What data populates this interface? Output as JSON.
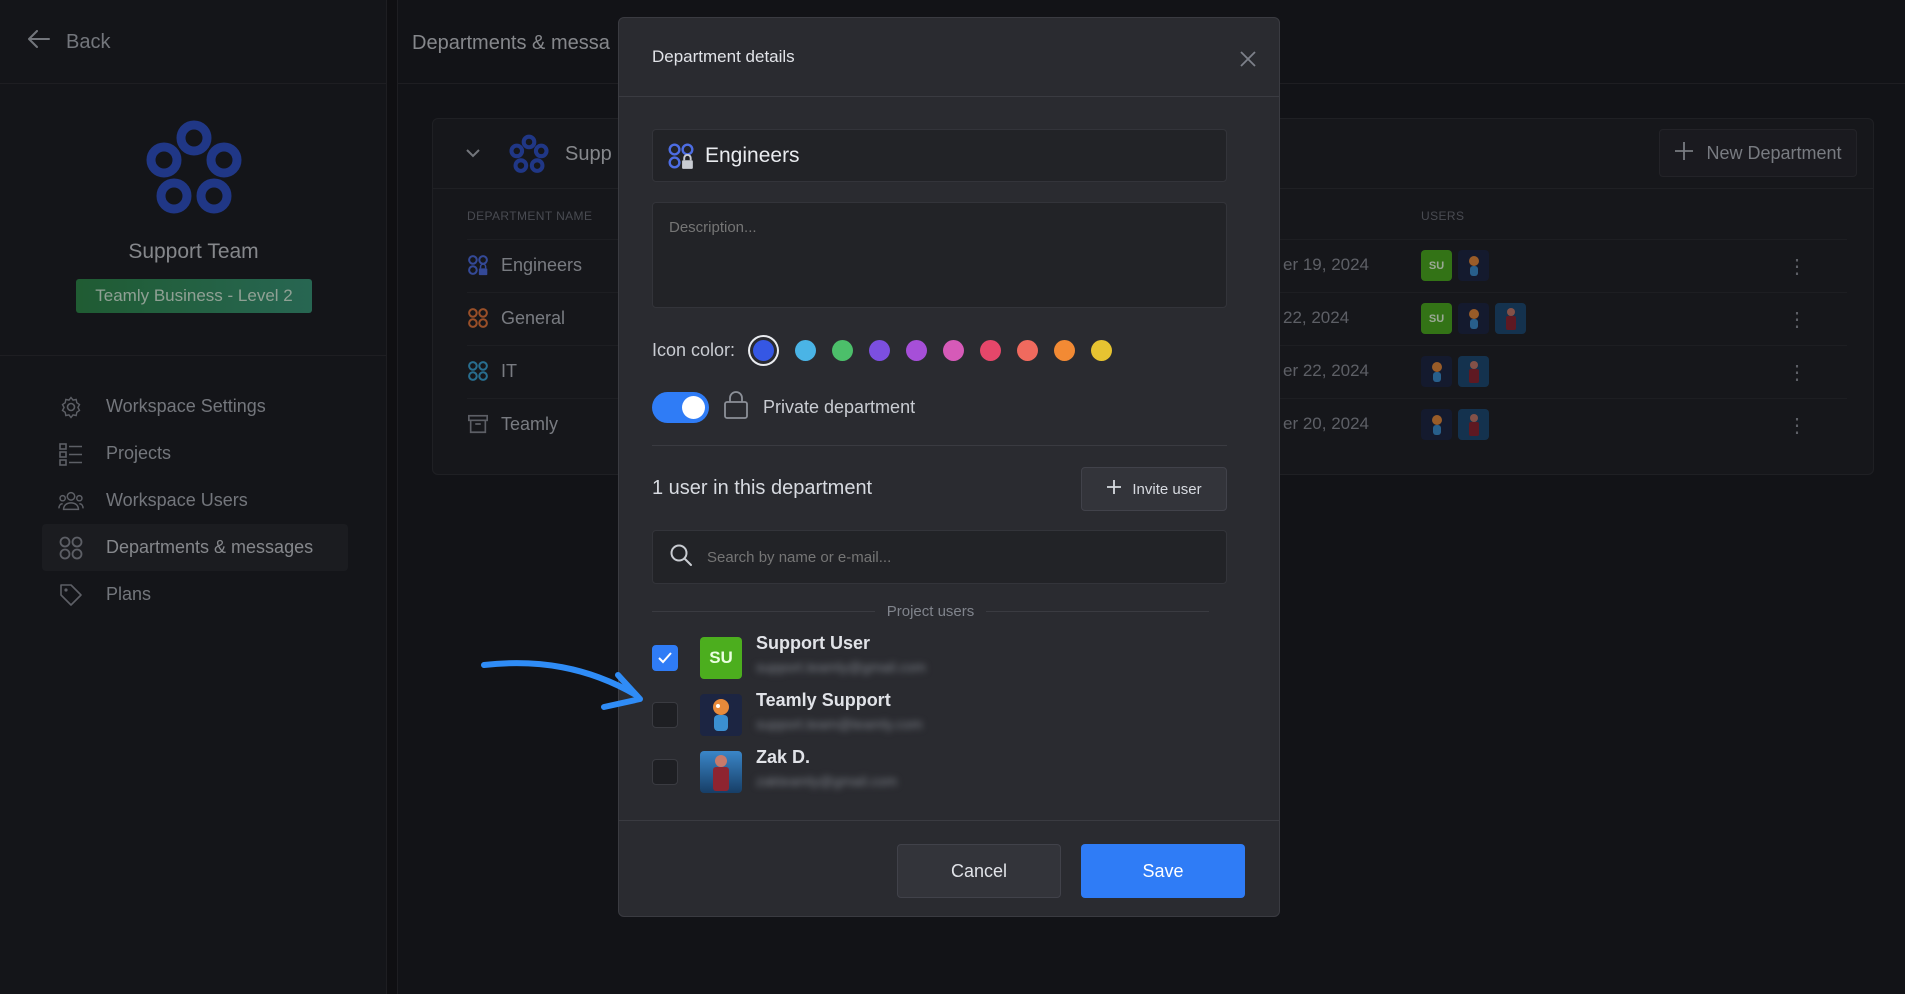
{
  "sidebar": {
    "back_label": "Back",
    "team_name": "Support Team",
    "plan_badge": "Teamly Business - Level 2",
    "items": [
      {
        "label": "Workspace Settings",
        "icon": "gear-icon"
      },
      {
        "label": "Projects",
        "icon": "list-icon"
      },
      {
        "label": "Workspace Users",
        "icon": "users-icon"
      },
      {
        "label": "Departments & messages",
        "icon": "grid-icon",
        "active": true
      },
      {
        "label": "Plans",
        "icon": "tag-icon"
      }
    ]
  },
  "main": {
    "title": "Departments & messa",
    "panel_title": "Supp",
    "new_department_label": "New Department",
    "col_department_name": "DEPARTMENT NAME",
    "col_users": "USERS",
    "rows": [
      {
        "name": "Engineers",
        "date": "er 19, 2024",
        "icon_color": "#4d6de3"
      },
      {
        "name": "General",
        "date": "22, 2024",
        "icon_color": "#e8773a"
      },
      {
        "name": "IT",
        "date": "er 22, 2024",
        "icon_color": "#3ba6d8"
      },
      {
        "name": "Teamly",
        "date": "er 20, 2024",
        "icon_color": "#8c9098"
      }
    ]
  },
  "modal": {
    "title": "Department details",
    "name_value": "Engineers",
    "description_placeholder": "Description...",
    "icon_color_label": "Icon color:",
    "colors": [
      "#3557e4",
      "#4ab4e6",
      "#4cbf6a",
      "#7c4fe0",
      "#a64fd8",
      "#d65ab8",
      "#e5476a",
      "#f06a5e",
      "#f28a34",
      "#e6c331"
    ],
    "selected_color": "#3557e4",
    "private_label": "Private department",
    "private_enabled": true,
    "user_count_text": "1 user in this department",
    "invite_label": "Invite user",
    "search_placeholder": "Search by name or e-mail...",
    "section_label": "Project users",
    "users": [
      {
        "name": "Support User",
        "initials": "SU",
        "checked": true,
        "email": "support.teamly@gmail.com"
      },
      {
        "name": "Teamly Support",
        "initials": "",
        "checked": false,
        "email": "support.team@teamly.com"
      },
      {
        "name": "Zak D.",
        "initials": "",
        "checked": false,
        "email": "zakteamly@gmail.com"
      }
    ],
    "cancel_label": "Cancel",
    "save_label": "Save"
  },
  "colors": {
    "accent": "#2f7cf6",
    "badge": "#2e8a4a",
    "su_avatar": "#4cae1e"
  }
}
